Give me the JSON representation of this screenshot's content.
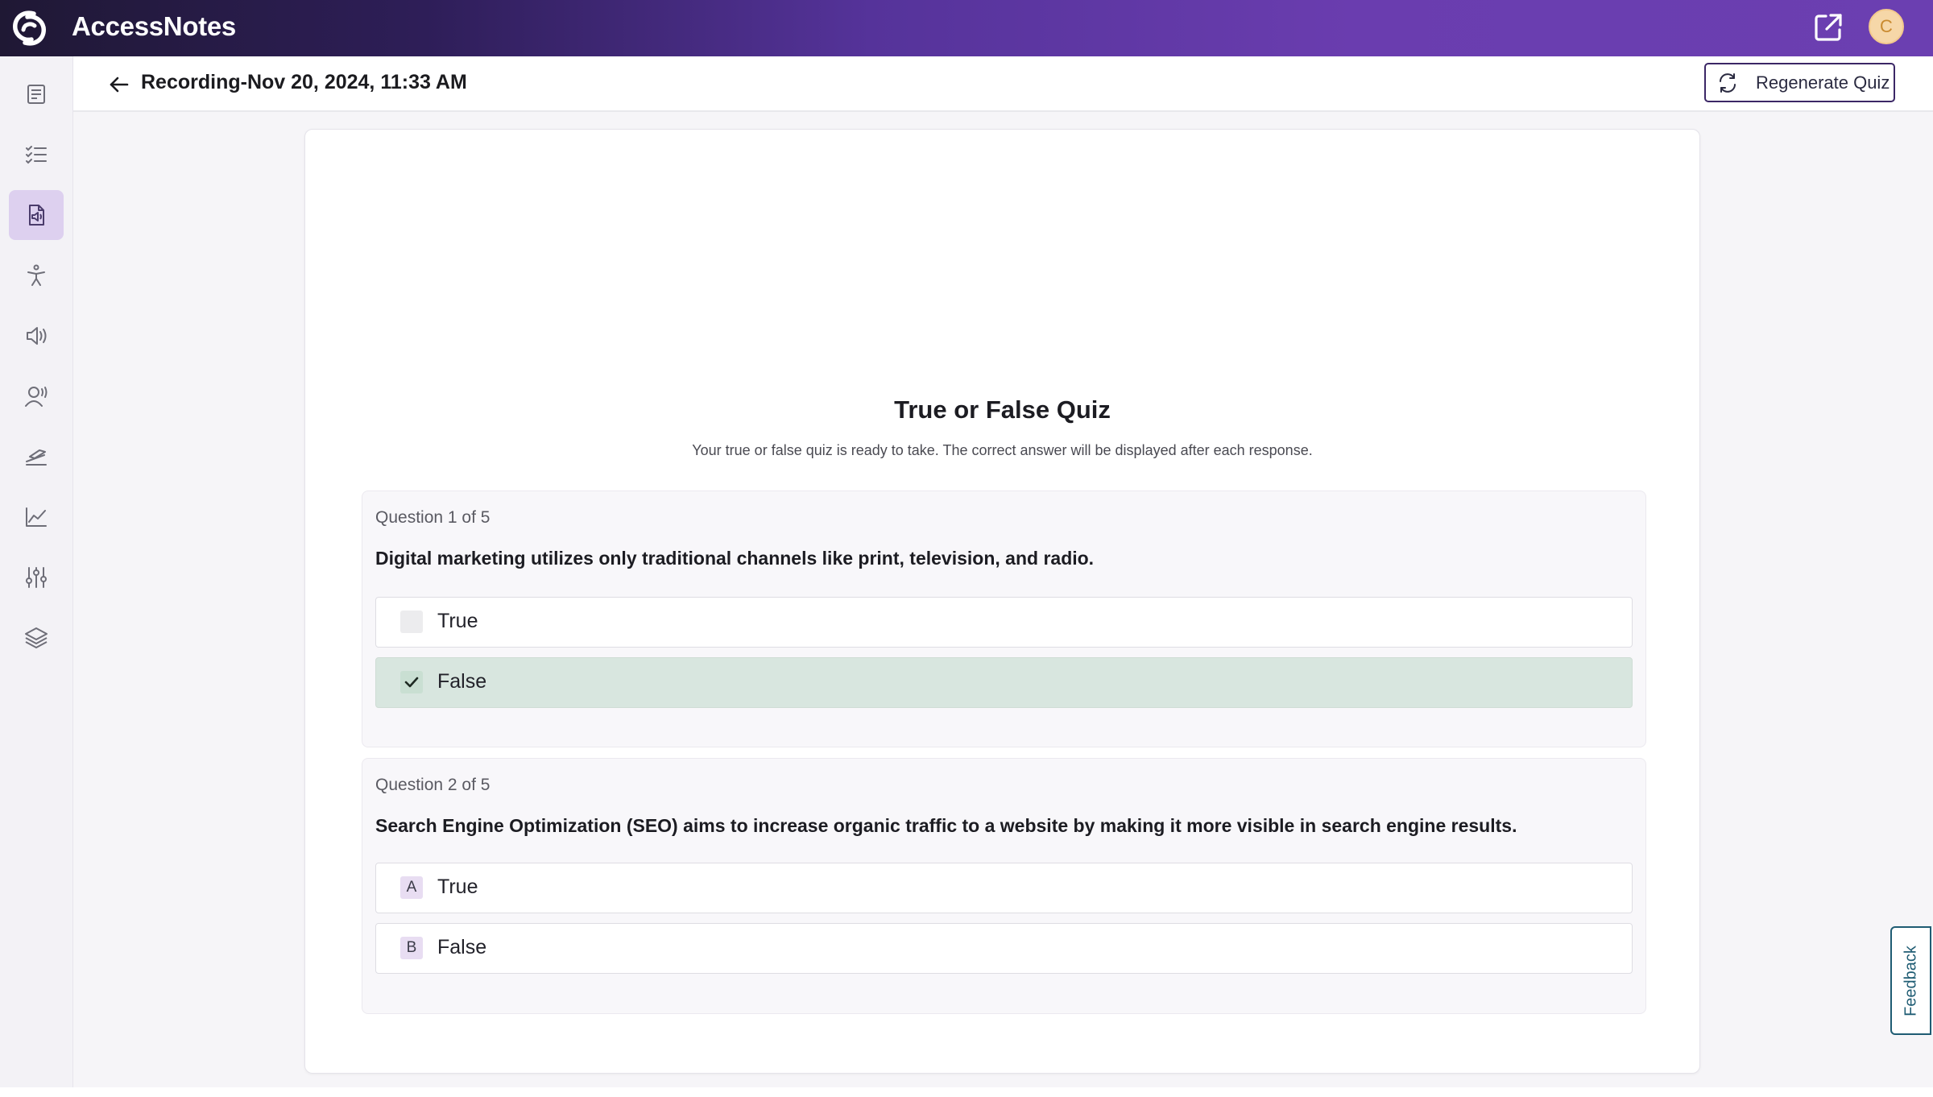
{
  "app": {
    "name": "AccessNotes"
  },
  "topbar": {
    "avatar_initial": "C"
  },
  "sidebar": {
    "items": [
      {
        "name": "notes-icon"
      },
      {
        "name": "checklist-icon"
      },
      {
        "name": "audio-file-icon",
        "active": true
      },
      {
        "name": "accessibility-icon"
      },
      {
        "name": "speaker-icon"
      },
      {
        "name": "voice-user-icon"
      },
      {
        "name": "learning-icon"
      },
      {
        "name": "analytics-chart-icon"
      },
      {
        "name": "settings-sliders-icon"
      },
      {
        "name": "layers-icon"
      }
    ]
  },
  "header": {
    "title": "Recording-Nov 20, 2024, 11:33 AM",
    "regenerate_label": "Regenerate Quiz"
  },
  "quiz": {
    "title": "True or False Quiz",
    "subtitle": "Your true or false quiz is ready to take. The correct answer will be displayed after each response.",
    "questions": [
      {
        "count": "Question 1 of 5",
        "text": "Digital marketing utilizes only traditional channels like print, television, and radio.",
        "options": [
          {
            "label": "True",
            "selected": false
          },
          {
            "label": "False",
            "selected": true
          }
        ]
      },
      {
        "count": "Question 2 of 5",
        "text": "Search Engine Optimization (SEO) aims to increase organic traffic to a website by making it more visible in search engine results.",
        "options": [
          {
            "letter": "A",
            "label": "True"
          },
          {
            "letter": "B",
            "label": "False"
          }
        ]
      }
    ]
  },
  "feedback": {
    "label": "Feedback"
  },
  "colors": {
    "accent": "#6b3fb1",
    "selected_answer": "#d8e6df",
    "feedback_border": "#1f5c73"
  }
}
